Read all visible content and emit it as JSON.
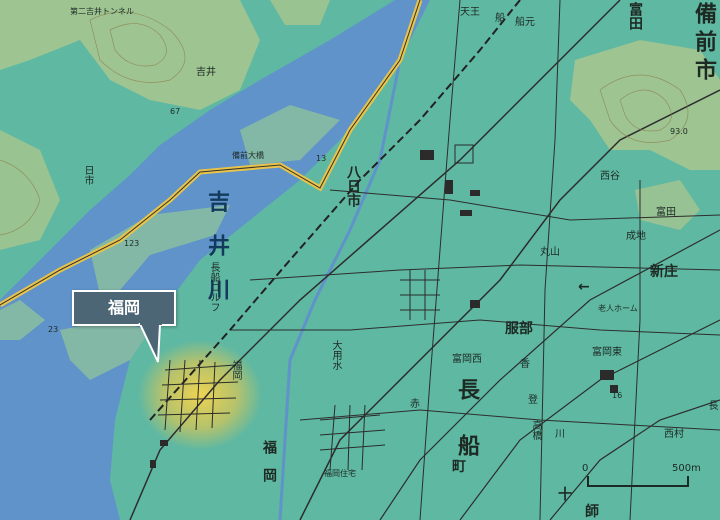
{
  "callout": {
    "label": "福岡"
  },
  "scale": {
    "start": "0",
    "end": "500m"
  },
  "river_labels": {
    "yoshii": "吉　井　川",
    "nagafune_gawa": "長船ゴルフ"
  },
  "places": {
    "yoshii": "吉井",
    "yoshii_tunnel": "第二吉井トンネル",
    "hinoichi": "日市",
    "youkaichi": "八日市",
    "tenno": "天王",
    "funa": "船",
    "funamoto": "船元",
    "tomita": "富田",
    "bizen_city": "備前市",
    "nishitani": "西谷",
    "tomita2": "富田",
    "maruyama": "丸山",
    "seichi": "成地",
    "shinjo": "新庄",
    "hattori": "服部",
    "rojin_home": "老人ホーム",
    "tomioka_nishi": "富岡西",
    "tomioka_higashi": "富岡東",
    "osafune": "長　船",
    "machi": "町",
    "fukuoka_east": "福岡",
    "fukuoka_south": "福　岡",
    "fukuoka_jutaku": "福岡住宅",
    "takahashi": "高橋",
    "shimura": "西村",
    "kanoe": "長",
    "yamada": "大用水",
    "aka": "赤",
    "toge": "十",
    "shi": "師",
    "kawa": "川",
    "kaori": "香",
    "kosato": "登",
    "kou": "高",
    "bizen_bridge": "備前大橋"
  },
  "spot_heights": {
    "a": "67",
    "b": "123",
    "c": "13",
    "d": "23",
    "e": "93.0",
    "f": "16"
  },
  "colors": {
    "land": "#5fb8a2",
    "hill": "#a7c48f",
    "river": "#5f93c9",
    "road_yellow": "#e9c44a",
    "highlight": "#f3d34e"
  }
}
